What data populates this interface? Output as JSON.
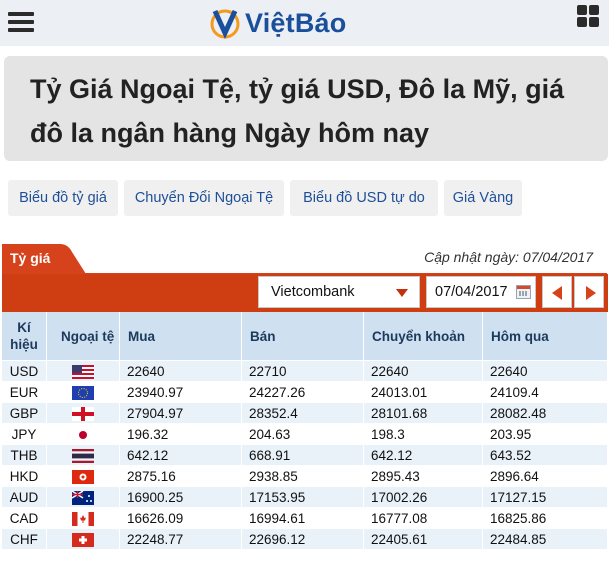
{
  "header": {
    "logo_text": "ViệtBáo",
    "brand_color": "#1a4f9c",
    "logo_accent_color": "#f39a1f"
  },
  "page_title": "Tỷ Giá Ngoại Tệ, tỷ giá USD, Đô la Mỹ, giá đô la ngân hàng Ngày hôm nay",
  "links": [
    "Biểu đồ tỷ giá",
    "Chuyển Đổi Ngoại Tệ",
    "Biểu đồ USD tự do",
    "Giá Vàng"
  ],
  "rate_panel": {
    "tab_label": "Tỷ giá",
    "updated_text": "Cập nhật ngày: 07/04/2017",
    "bank_select_value": "Vietcombank",
    "date_value": "07/04/2017",
    "accent_color": "#d6421b",
    "icons": [
      "calendar-icon",
      "prev-arrow-icon",
      "next-arrow-icon"
    ]
  },
  "table": {
    "headers": {
      "code": "Kí hiệu",
      "currency": "Ngoại tệ",
      "buy": "Mua",
      "sell": "Bán",
      "transfer": "Chuyển khoản",
      "yesterday": "Hôm qua"
    },
    "rows": [
      {
        "code": "USD",
        "flag": "us-flag-icon",
        "buy": "22640",
        "sell": "22710",
        "transfer": "22640",
        "yesterday": "22640"
      },
      {
        "code": "EUR",
        "flag": "eu-flag-icon",
        "buy": "23940.97",
        "sell": "24227.26",
        "transfer": "24013.01",
        "yesterday": "24109.4"
      },
      {
        "code": "GBP",
        "flag": "england-flag-icon",
        "buy": "27904.97",
        "sell": "28352.4",
        "transfer": "28101.68",
        "yesterday": "28082.48"
      },
      {
        "code": "JPY",
        "flag": "japan-flag-icon",
        "buy": "196.32",
        "sell": "204.63",
        "transfer": "198.3",
        "yesterday": "203.95"
      },
      {
        "code": "THB",
        "flag": "thailand-flag-icon",
        "buy": "642.12",
        "sell": "668.91",
        "transfer": "642.12",
        "yesterday": "643.52"
      },
      {
        "code": "HKD",
        "flag": "hongkong-flag-icon",
        "buy": "2875.16",
        "sell": "2938.85",
        "transfer": "2895.43",
        "yesterday": "2896.64"
      },
      {
        "code": "AUD",
        "flag": "australia-flag-icon",
        "buy": "16900.25",
        "sell": "17153.95",
        "transfer": "17002.26",
        "yesterday": "17127.15"
      },
      {
        "code": "CAD",
        "flag": "canada-flag-icon",
        "buy": "16626.09",
        "sell": "16994.61",
        "transfer": "16777.08",
        "yesterday": "16825.86"
      },
      {
        "code": "CHF",
        "flag": "switzerland-flag-icon",
        "buy": "22248.77",
        "sell": "22696.12",
        "transfer": "22405.61",
        "yesterday": "22484.85"
      }
    ]
  }
}
